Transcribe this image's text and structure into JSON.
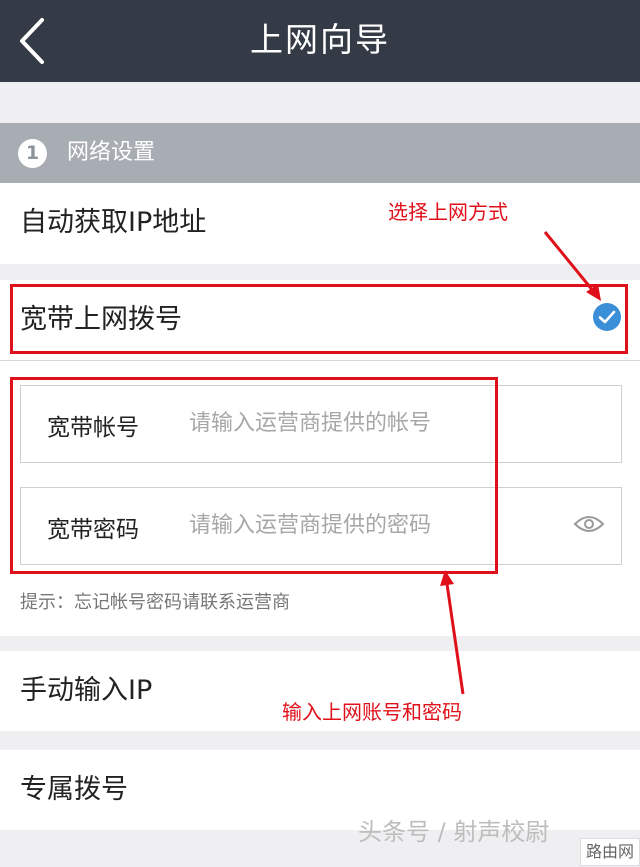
{
  "header": {
    "title": "上网向导",
    "back_icon": "chevron-left-icon"
  },
  "section": {
    "number": "1",
    "label": "网络设置"
  },
  "options": {
    "auto_ip": "自动获取IP地址",
    "pppoe": "宽带上网拨号",
    "manual_ip": "手动输入IP",
    "dedicated_dial": "专属拨号"
  },
  "pppoe_form": {
    "account_label": "宽带帐号",
    "account_placeholder": "请输入运营商提供的帐号",
    "password_label": "宽带密码",
    "password_placeholder": "请输入运营商提供的密码",
    "hint": "提示：忘记帐号密码请联系运营商"
  },
  "annotations": {
    "select_method": "选择上网方式",
    "enter_credentials": "输入上网账号和密码"
  },
  "watermark": {
    "text": "头条号 / 射声校尉",
    "logo": "路由网"
  },
  "colors": {
    "header_bg": "#343b46",
    "section_bg": "#a8adb4",
    "check": "#3b8fd9",
    "annotation": "#e0101a"
  }
}
